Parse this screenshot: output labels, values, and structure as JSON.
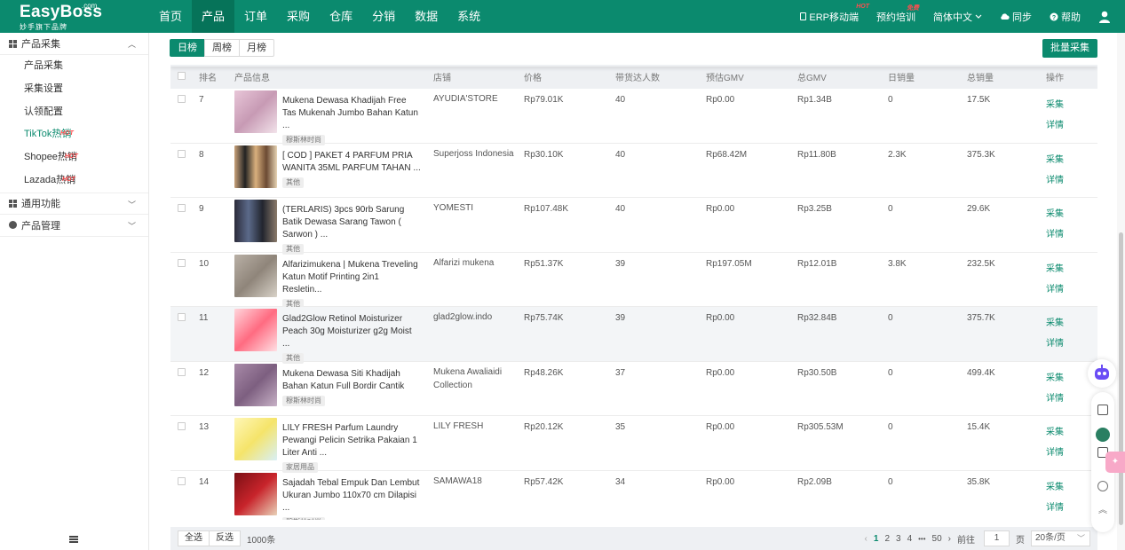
{
  "brand": {
    "name": "EasyBoss",
    "com": ".com",
    "tagline": "妙手旗下品牌"
  },
  "nav": {
    "items": [
      {
        "label": "首页"
      },
      {
        "label": "产品"
      },
      {
        "label": "订单"
      },
      {
        "label": "采购"
      },
      {
        "label": "仓库"
      },
      {
        "label": "分销"
      },
      {
        "label": "数据"
      },
      {
        "label": "系统"
      }
    ],
    "active_index": 1,
    "right": {
      "erp_mobile": "ERP移动端",
      "erp_badge": "HOT",
      "training": "预约培训",
      "training_badge": "免费",
      "language": "简体中文",
      "sync": "同步",
      "help": "帮助"
    }
  },
  "sidebar": {
    "group1": "产品采集",
    "items": [
      {
        "label": "产品采集",
        "hot": ""
      },
      {
        "label": "采集设置",
        "hot": ""
      },
      {
        "label": "认领配置",
        "hot": ""
      },
      {
        "label": "TikTok热销",
        "hot": "HOT"
      },
      {
        "label": "Shopee热销",
        "hot": "HOT"
      },
      {
        "label": "Lazada热销",
        "hot": "HOT"
      }
    ],
    "group2": "通用功能",
    "group3": "产品管理"
  },
  "toolbar": {
    "tabs": [
      {
        "label": "日榜"
      },
      {
        "label": "周榜"
      },
      {
        "label": "月榜"
      }
    ],
    "bulk_button": "批量采集"
  },
  "table": {
    "headers": {
      "rank": "排名",
      "info": "产品信息",
      "shop": "店铺",
      "price": "价格",
      "influencers": "带货达人数",
      "est_gmv": "预估GMV",
      "total_gmv": "总GMV",
      "daily_sales": "日销量",
      "total_sales": "总销量",
      "ops": "操作"
    },
    "op_collect": "采集",
    "op_detail": "详情",
    "rows": [
      {
        "rank": "7",
        "title": "Mukena Dewasa Khadijah Free Tas Mukenah Jumbo Bahan Katun ...",
        "tag": "穆斯林时尚",
        "shop": "AYUDIA'STORE",
        "price": "Rp79.01K",
        "influencers": "40",
        "est_gmv": "Rp0.00",
        "total_gmv": "Rp1.34B",
        "daily_sales": "0",
        "total_sales": "17.5K"
      },
      {
        "rank": "8",
        "title": "[ COD ] PAKET 4 PARFUM PRIA WANITA 35ML PARFUM TAHAN ...",
        "tag": "其他",
        "shop": "Superjoss Indonesia",
        "price": "Rp30.10K",
        "influencers": "40",
        "est_gmv": "Rp68.42M",
        "total_gmv": "Rp11.80B",
        "daily_sales": "2.3K",
        "total_sales": "375.3K"
      },
      {
        "rank": "9",
        "title": "(TERLARIS) 3pcs 90rb Sarung Batik Dewasa Sarang Tawon ( Sarwon ) ...",
        "tag": "其他",
        "shop": "YOMESTI",
        "price": "Rp107.48K",
        "influencers": "40",
        "est_gmv": "Rp0.00",
        "total_gmv": "Rp3.25B",
        "daily_sales": "0",
        "total_sales": "29.6K"
      },
      {
        "rank": "10",
        "title": "Alfarizimukena | Mukena Treveling Katun Motif Printing 2in1 Resletin...",
        "tag": "其他",
        "shop": "Alfarizi mukena",
        "price": "Rp51.37K",
        "influencers": "39",
        "est_gmv": "Rp197.05M",
        "total_gmv": "Rp12.01B",
        "daily_sales": "3.8K",
        "total_sales": "232.5K"
      },
      {
        "rank": "11",
        "title": "Glad2Glow Retinol Moisturizer Peach 30g Moisturizer g2g Moist ...",
        "tag": "其他",
        "shop": "glad2glow.indo",
        "price": "Rp75.74K",
        "influencers": "39",
        "est_gmv": "Rp0.00",
        "total_gmv": "Rp32.84B",
        "daily_sales": "0",
        "total_sales": "375.7K"
      },
      {
        "rank": "12",
        "title": "Mukena Dewasa Siti Khadijah Bahan Katun Full Bordir Cantik",
        "tag": "穆斯林时尚",
        "shop": "Mukena Awaliaidi Collection",
        "price": "Rp48.26K",
        "influencers": "37",
        "est_gmv": "Rp0.00",
        "total_gmv": "Rp30.50B",
        "daily_sales": "0",
        "total_sales": "499.4K"
      },
      {
        "rank": "13",
        "title": "LILY FRESH Parfum Laundry Pewangi Pelicin Setrika Pakaian 1 Liter Anti ...",
        "tag": "家居用品",
        "shop": "LILY FRESH",
        "price": "Rp20.12K",
        "influencers": "35",
        "est_gmv": "Rp0.00",
        "total_gmv": "Rp305.53M",
        "daily_sales": "0",
        "total_sales": "15.4K"
      },
      {
        "rank": "14",
        "title": "Sajadah Tebal Empuk Dan Lembut Ukuran Jumbo 110x70 cm Dilapisi ...",
        "tag": "穆斯林时尚",
        "shop": "SAMAWA18",
        "price": "Rp57.42K",
        "influencers": "34",
        "est_gmv": "Rp0.00",
        "total_gmv": "Rp2.09B",
        "daily_sales": "0",
        "total_sales": "35.8K"
      }
    ]
  },
  "footer": {
    "select_all": "全选",
    "invert": "反选",
    "total": "1000条",
    "pages": [
      "1",
      "2",
      "3",
      "4"
    ],
    "ellipsis": "•••",
    "last_page": "50",
    "goto_label": "前往",
    "goto_value": "1",
    "page_suffix": "页",
    "page_size": "20条/页"
  },
  "colors": {
    "primary": "#0b8a6e",
    "hot": "#ff4d4f"
  },
  "icons": [
    "erp-mobile-icon",
    "chevron-down-icon",
    "cloud-sync-icon",
    "help-icon",
    "user-icon",
    "grid-icon",
    "gear-icon",
    "menu-icon",
    "robot-icon"
  ]
}
